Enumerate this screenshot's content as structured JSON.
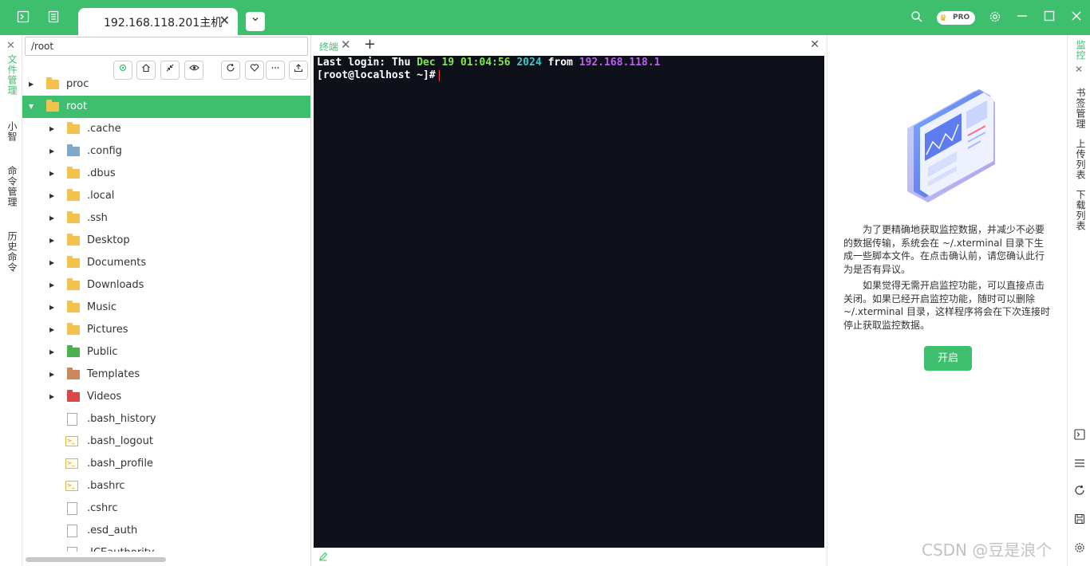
{
  "titlebar": {
    "tab_title": "192.168.118.201主机",
    "tab_close": "✕",
    "dropdown": "⌄",
    "pro_label": "PRO",
    "icons": [
      "terminal-icon",
      "list-icon",
      "search-icon",
      "gear-icon",
      "minimize-icon",
      "maximize-icon",
      "close-icon"
    ]
  },
  "left_strip": {
    "items": [
      {
        "label": "文件管理",
        "active": true
      },
      {
        "label": "小智",
        "active": false
      },
      {
        "label": "命令管理",
        "active": false
      },
      {
        "label": "历史命令",
        "active": false
      }
    ],
    "close": "✕"
  },
  "filepanel": {
    "path": "/root",
    "toolbar": [
      "locate-icon",
      "home-icon",
      "collapse-icon",
      "eye-icon",
      "refresh-icon",
      "heart-icon",
      "more-icon",
      "upload-icon"
    ],
    "tree": [
      {
        "name": "proc",
        "kind": "folder",
        "depth": 0,
        "expanded": false
      },
      {
        "name": "root",
        "kind": "folder",
        "depth": 0,
        "expanded": true,
        "selected": true
      },
      {
        "name": ".cache",
        "kind": "folder",
        "depth": 1
      },
      {
        "name": ".config",
        "kind": "folder-config",
        "depth": 1
      },
      {
        "name": ".dbus",
        "kind": "folder",
        "depth": 1
      },
      {
        "name": ".local",
        "kind": "folder",
        "depth": 1
      },
      {
        "name": ".ssh",
        "kind": "folder",
        "depth": 1
      },
      {
        "name": "Desktop",
        "kind": "folder",
        "depth": 1
      },
      {
        "name": "Documents",
        "kind": "folder",
        "depth": 1
      },
      {
        "name": "Downloads",
        "kind": "folder",
        "depth": 1
      },
      {
        "name": "Music",
        "kind": "folder",
        "depth": 1
      },
      {
        "name": "Pictures",
        "kind": "folder",
        "depth": 1
      },
      {
        "name": "Public",
        "kind": "folder-public",
        "depth": 1
      },
      {
        "name": "Templates",
        "kind": "folder-templates",
        "depth": 1
      },
      {
        "name": "Videos",
        "kind": "folder-videos",
        "depth": 1
      },
      {
        "name": ".bash_history",
        "kind": "file",
        "depth": 1
      },
      {
        "name": ".bash_logout",
        "kind": "shell",
        "depth": 1
      },
      {
        "name": ".bash_profile",
        "kind": "shell",
        "depth": 1
      },
      {
        "name": ".bashrc",
        "kind": "shell",
        "depth": 1
      },
      {
        "name": ".cshrc",
        "kind": "file",
        "depth": 1
      },
      {
        "name": ".esd_auth",
        "kind": "file",
        "depth": 1
      },
      {
        "name": ".ICEauthority",
        "kind": "file",
        "depth": 1
      }
    ]
  },
  "terminal": {
    "tab_label": "终端",
    "tab_close": "✕",
    "add": "+",
    "panel_close": "✕",
    "line1": {
      "a": "Last login: Thu ",
      "b": "Dec 19 01:04:56",
      "c": " ",
      "d": "2024",
      "e": " from ",
      "f": "192.168.118.1"
    },
    "prompt": "[root@localhost ~]#",
    "colors": {
      "background": "#0e111a",
      "green": "#7de84e",
      "cyan": "#3fc6c8",
      "purple": "#c05cf0"
    }
  },
  "monitor": {
    "paragraph1": "为了更精确地获取监控数据，并减少不必要的数据传输，系统会在 ~/.xterminal 目录下生成一些脚本文件。在点击确认前，请您确认此行为是否有异议。",
    "paragraph2": "如果觉得无需开启监控功能，可以直接点击关闭。如果已经开启监控功能，随时可以删除 ~/.xterminal 目录，这样程序将会在下次连接时停止获取监控数据。",
    "button": "开启"
  },
  "right_strip": {
    "items": [
      {
        "label": "监控",
        "active": true
      },
      {
        "label": "书签管理",
        "active": false
      },
      {
        "label": "上传列表",
        "active": false
      },
      {
        "label": "下载列表",
        "active": false
      }
    ],
    "close": "✕",
    "icons": [
      "terminal-icon",
      "list-icon",
      "refresh-icon",
      "save-icon",
      "settings-icon"
    ]
  },
  "watermark": "CSDN @豆是浪个",
  "theme": {
    "accent": "#3dbf6e"
  }
}
